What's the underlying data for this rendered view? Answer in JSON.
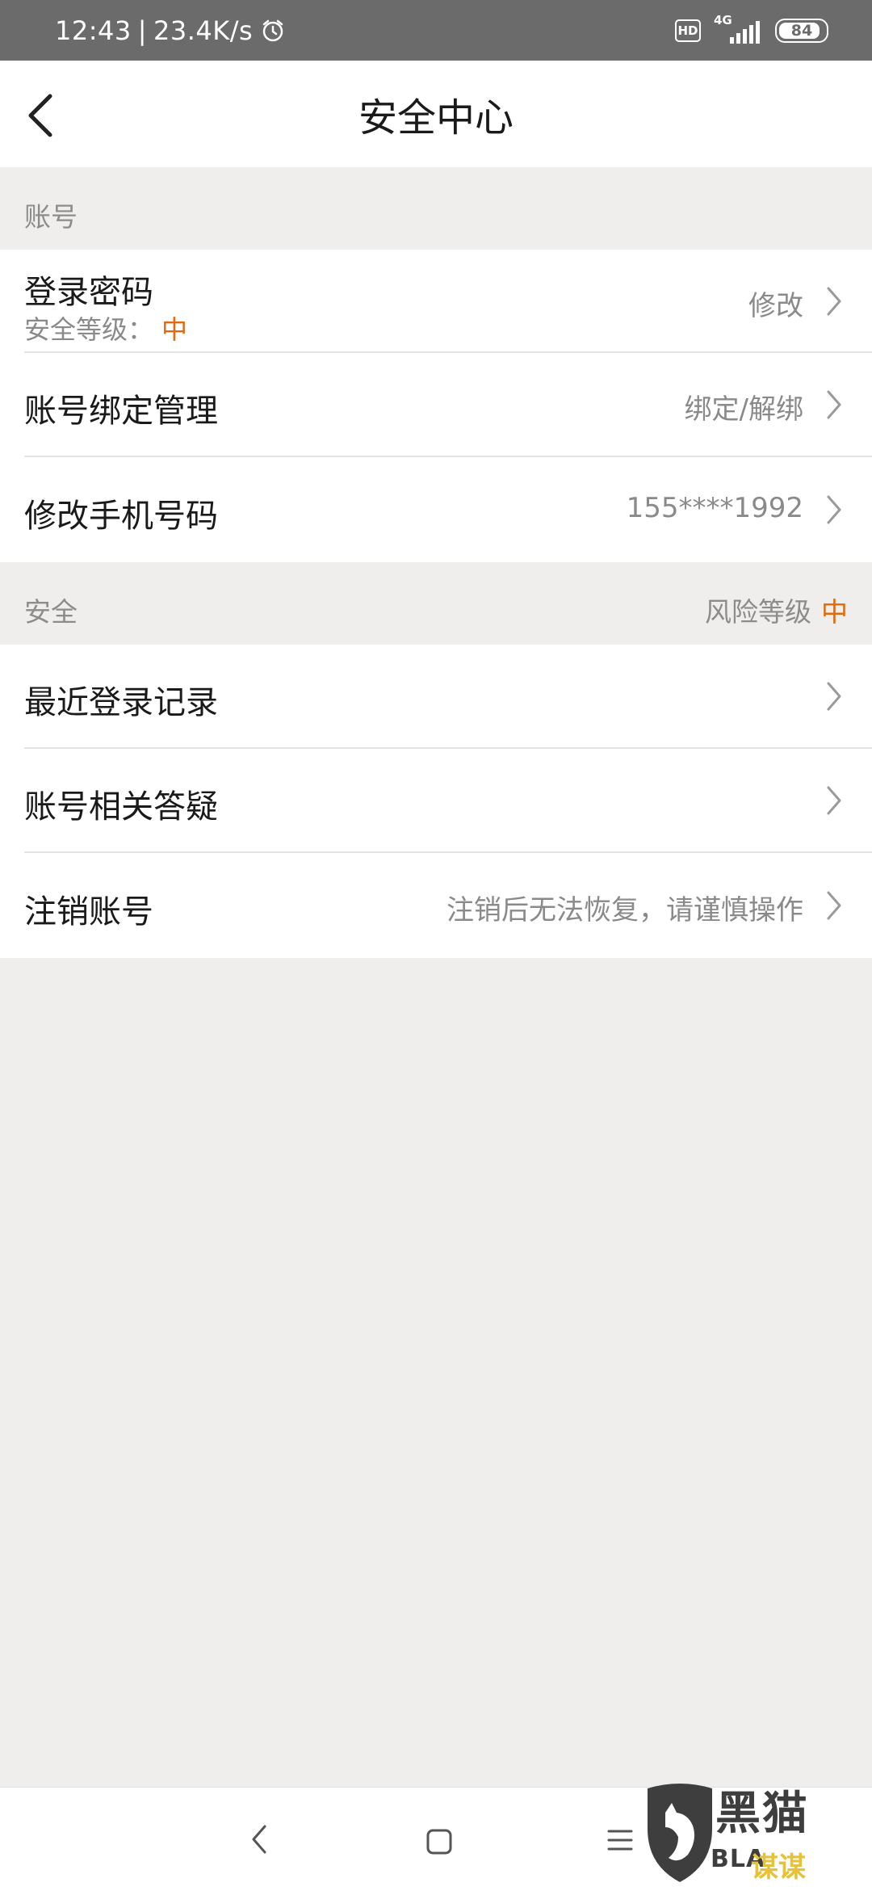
{
  "status_bar": {
    "time": "12:43",
    "separator": "|",
    "net_speed": "23.4K/s",
    "hd": "HD",
    "network": "4G",
    "battery": "84"
  },
  "header": {
    "title": "安全中心"
  },
  "sections": {
    "account": {
      "label": "账号",
      "items": {
        "login_password": {
          "title": "登录密码",
          "sub_label": "安全等级：",
          "sub_value": "中",
          "action": "修改"
        },
        "binding": {
          "title": "账号绑定管理",
          "action": "绑定/解绑"
        },
        "phone": {
          "title": "修改手机号码",
          "value": "155****1992"
        }
      }
    },
    "security": {
      "label": "安全",
      "risk_label": "风险等级",
      "risk_value": "中",
      "items": {
        "login_records": {
          "title": "最近登录记录"
        },
        "faq": {
          "title": "账号相关答疑"
        },
        "deactivate": {
          "title": "注销账号",
          "hint": "注销后无法恢复，请谨慎操作"
        }
      }
    }
  },
  "watermark": {
    "cn": "黑猫",
    "en": "BLA",
    "sub": "谋谋"
  },
  "colors": {
    "accent_orange": "#e06a12",
    "status_bar": "#6b6b6b",
    "page_bg": "#efeeed"
  },
  "icons": [
    "back-arrow-icon",
    "chevron-right-icon",
    "alarm-clock-icon",
    "signal-icon",
    "battery-icon",
    "nav-back-icon",
    "nav-home-icon",
    "nav-menu-icon"
  ]
}
